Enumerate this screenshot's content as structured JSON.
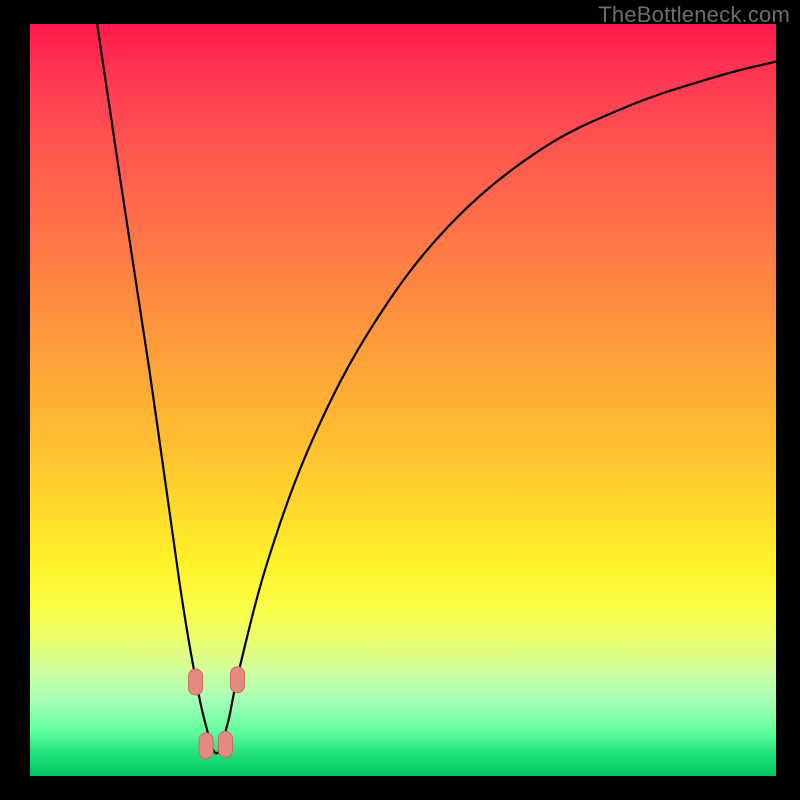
{
  "watermark": "TheBottleneck.com",
  "colors": {
    "frame": "#000000",
    "curve": "#000000",
    "marker_fill": "#e48a80",
    "marker_stroke": "#cc6a5e"
  },
  "chart_data": {
    "type": "line",
    "title": "",
    "xlabel": "",
    "ylabel": "",
    "xlim": [
      0,
      100
    ],
    "ylim": [
      0,
      100
    ],
    "grid": false,
    "legend": false,
    "notes": "V-shaped bottleneck curve; y decreases sharply from top-left, reaches minimum near x≈25, then rises with diminishing slope toward top-right. Markers cluster near the trough.",
    "series": [
      {
        "name": "curve",
        "x": [
          9,
          12,
          16,
          20,
          22,
          23.5,
          25,
          26.5,
          28,
          32,
          38,
          46,
          56,
          68,
          80,
          92,
          100
        ],
        "y": [
          100,
          80,
          54,
          26,
          14,
          7,
          3,
          7,
          14,
          29,
          45,
          60,
          73,
          83,
          89,
          93,
          95
        ]
      }
    ],
    "markers": [
      {
        "x": 22.2,
        "y": 12.5
      },
      {
        "x": 23.6,
        "y": 4.0
      },
      {
        "x": 26.2,
        "y": 4.2
      },
      {
        "x": 27.8,
        "y": 12.8
      }
    ]
  }
}
